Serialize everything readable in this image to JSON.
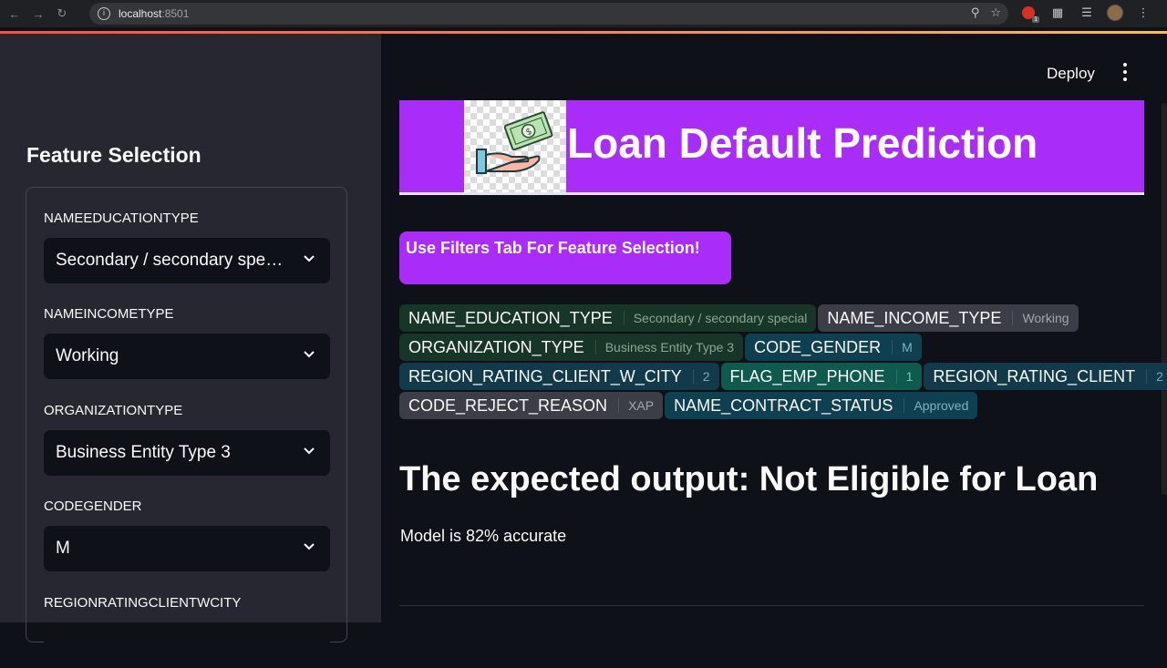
{
  "browser": {
    "url_host": "localhost",
    "url_port": ":8501",
    "ext_badge": "1"
  },
  "sidebar": {
    "title": "Feature Selection",
    "fields": [
      {
        "label": "NAMEEDUCATIONTYPE",
        "value": "Secondary / secondary special"
      },
      {
        "label": "NAMEINCOMETYPE",
        "value": "Working"
      },
      {
        "label": "ORGANIZATIONTYPE",
        "value": "Business Entity Type 3"
      },
      {
        "label": "CODEGENDER",
        "value": "M"
      },
      {
        "label": "REGIONRATINGCLIENTWCITY",
        "value": ""
      }
    ]
  },
  "header": {
    "deploy_label": "Deploy"
  },
  "banner": {
    "title": "Loan Default Prediction",
    "bg_color": "#a92cf9"
  },
  "note": "Use Filters Tab For Feature Selection!",
  "tags": [
    {
      "key": "NAME_EDUCATION_TYPE",
      "value": "Secondary / secondary special"
    },
    {
      "key": "NAME_INCOME_TYPE",
      "value": "Working"
    },
    {
      "key": "ORGANIZATION_TYPE",
      "value": "Business Entity Type 3"
    },
    {
      "key": "CODE_GENDER",
      "value": "M"
    },
    {
      "key": "REGION_RATING_CLIENT_W_CITY",
      "value": "2"
    },
    {
      "key": "FLAG_EMP_PHONE",
      "value": "1"
    },
    {
      "key": "REGION_RATING_CLIENT",
      "value": "2"
    },
    {
      "key": "CODE_REJECT_REASON",
      "value": "XAP"
    },
    {
      "key": "NAME_CONTRACT_STATUS",
      "value": "Approved"
    }
  ],
  "result": {
    "heading": "The expected output: Not Eligible for Loan",
    "accuracy": "Model is 82% accurate"
  }
}
